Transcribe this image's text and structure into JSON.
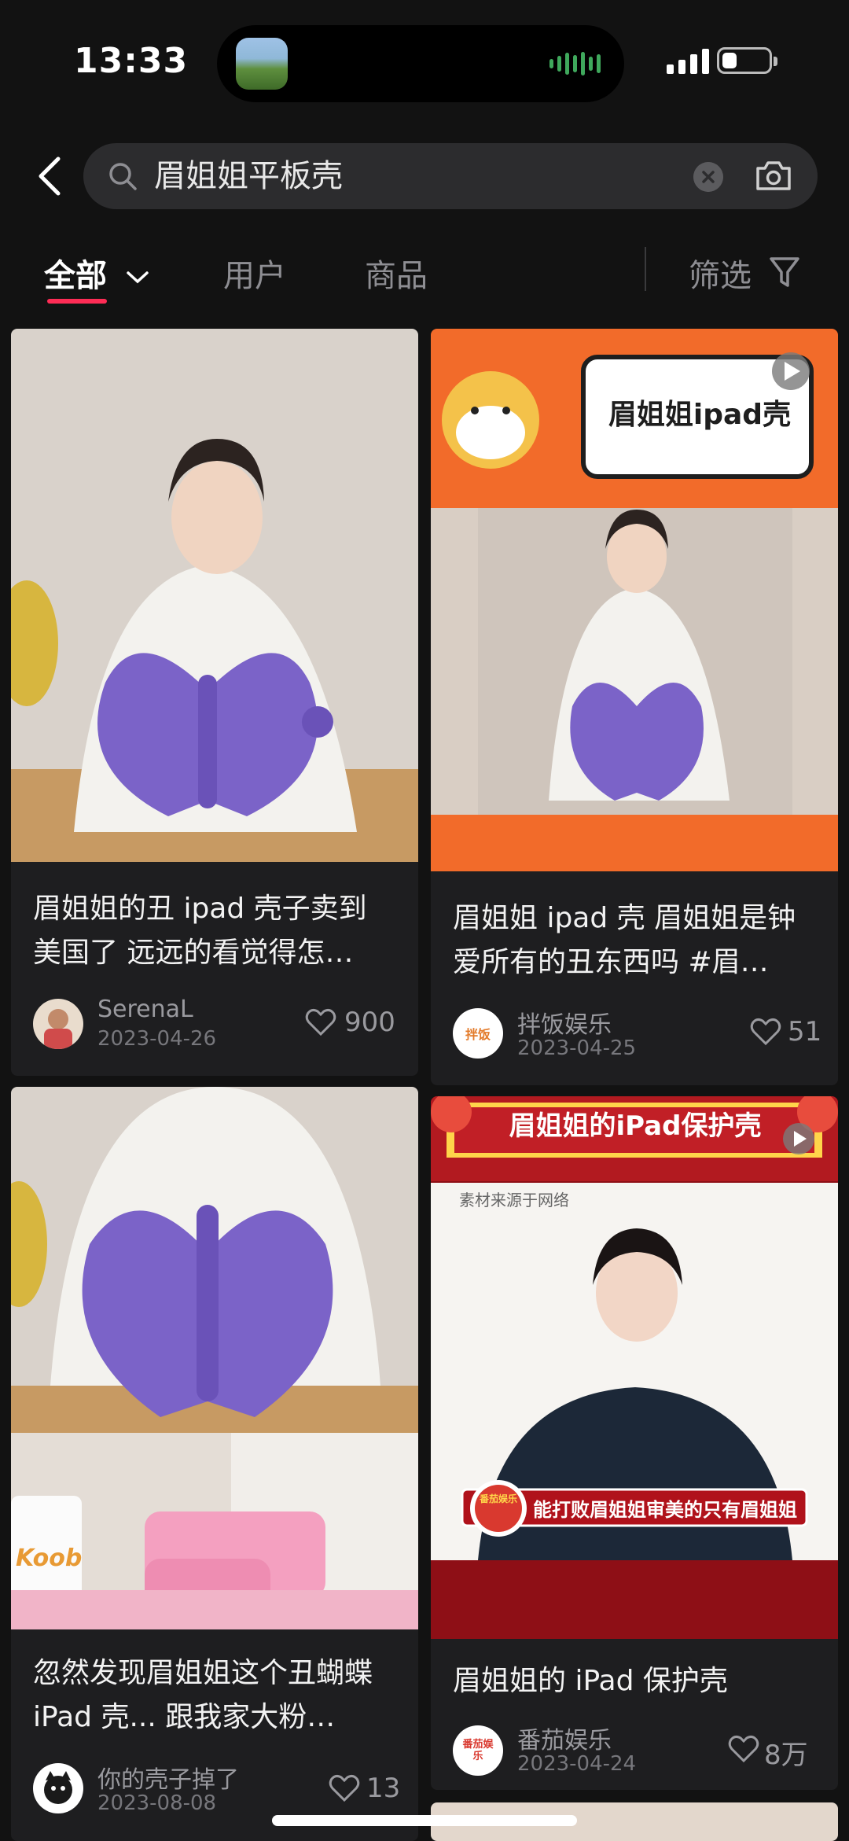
{
  "status_bar": {
    "time": "13:33"
  },
  "search": {
    "query": "眉姐姐平板壳"
  },
  "tabs": {
    "all": "全部",
    "users": "用户",
    "products": "商品",
    "filter": "筛选"
  },
  "cards": [
    {
      "title": "眉姐姐的丑 ipad 壳子卖到美国了 远远的看觉得怎…",
      "author": "SerenaL",
      "date": "2023-04-26",
      "likes": "900"
    },
    {
      "image_text": "眉姐姐ipad壳",
      "title": "眉姐姐 ipad 壳 眉姐姐是钟爱所有的丑东西吗 #眉…",
      "author": "拌饭娱乐",
      "avatar_text": "拌饭",
      "date": "2023-04-25",
      "likes": "51"
    },
    {
      "image_text": "Koob",
      "title": "忽然发现眉姐姐这个丑蝴蝶 iPad 壳... 跟我家大粉…",
      "author": "你的壳子掉了",
      "date": "2023-08-08",
      "likes": "13"
    },
    {
      "banner_text": "眉姐姐的iPad保护壳",
      "source_text": "素材来源于网络",
      "caption_text": "能打败眉姐姐审美的只有眉姐姐",
      "badge_text": "番茄娱乐",
      "title": "眉姐姐的 iPad 保护壳",
      "author": "番茄娱乐",
      "avatar_text": "番茄娱乐",
      "date": "2023-04-24",
      "likes": "8万"
    }
  ]
}
